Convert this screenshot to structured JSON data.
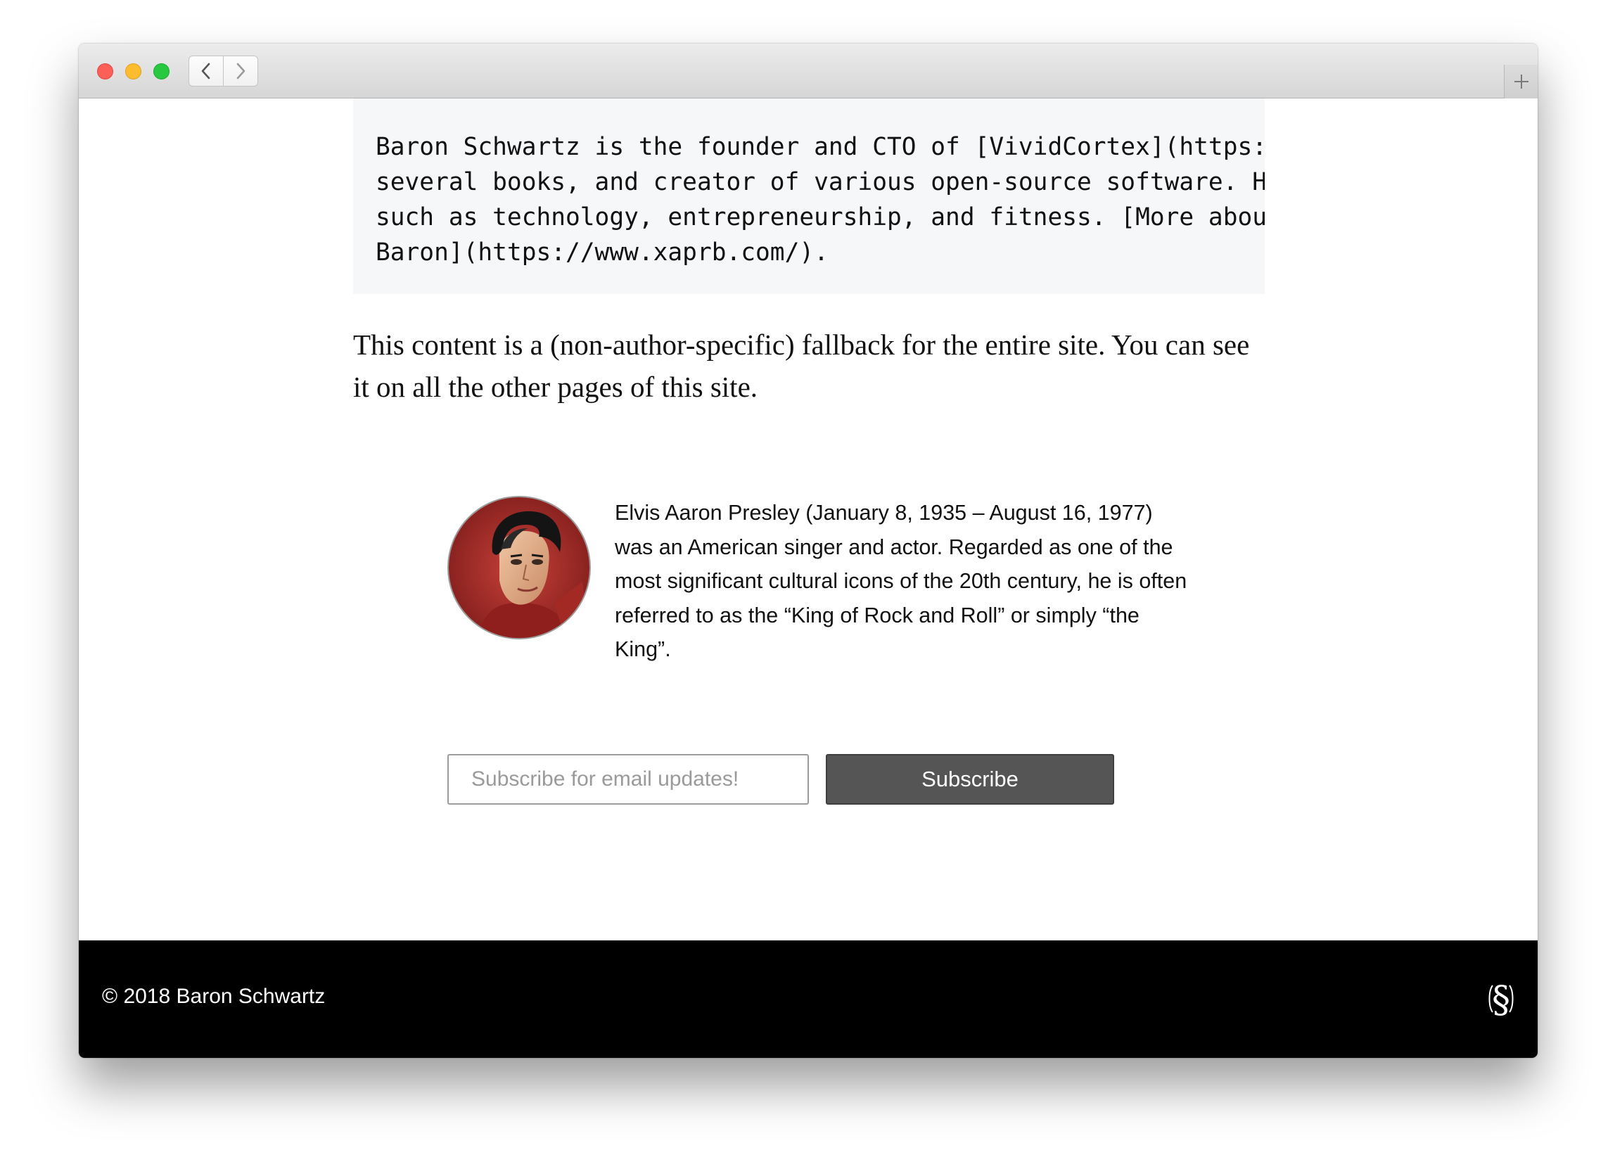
{
  "browser": {
    "back_icon": "chevron-left-icon",
    "forward_icon": "chevron-right-icon",
    "new_tab_icon": "plus-icon"
  },
  "code_block": {
    "lines": [
      "Baron Schwartz is the founder and CTO of [VividCortex](https://viv",
      "several books, and creator of various open-source software. He wri",
      "such as technology, entrepreneurship, and fitness. [More about",
      "Baron](https://www.xaprb.com/)."
    ]
  },
  "fallback_text": "This content is a (non-author-specific) fallback for the entire site. You can see it on all the other pages of this site.",
  "author": {
    "avatar_alt": "Elvis Aaron Presley",
    "bio": "Elvis Aaron Presley (January 8, 1935 – August 16, 1977) was an American singer and actor. Regarded as one of the most significant cultural icons of the 20th century, he is often referred to as the “King of Rock and Roll” or simply “the King”."
  },
  "subscribe": {
    "placeholder": "Subscribe for email updates!",
    "button_label": "Subscribe"
  },
  "footer": {
    "copyright": "© 2018 Baron Schwartz",
    "logo_icon": "section-sign-logo"
  },
  "colors": {
    "button_bg": "#555555",
    "footer_bg": "#000000",
    "code_bg": "#f6f7f9"
  }
}
